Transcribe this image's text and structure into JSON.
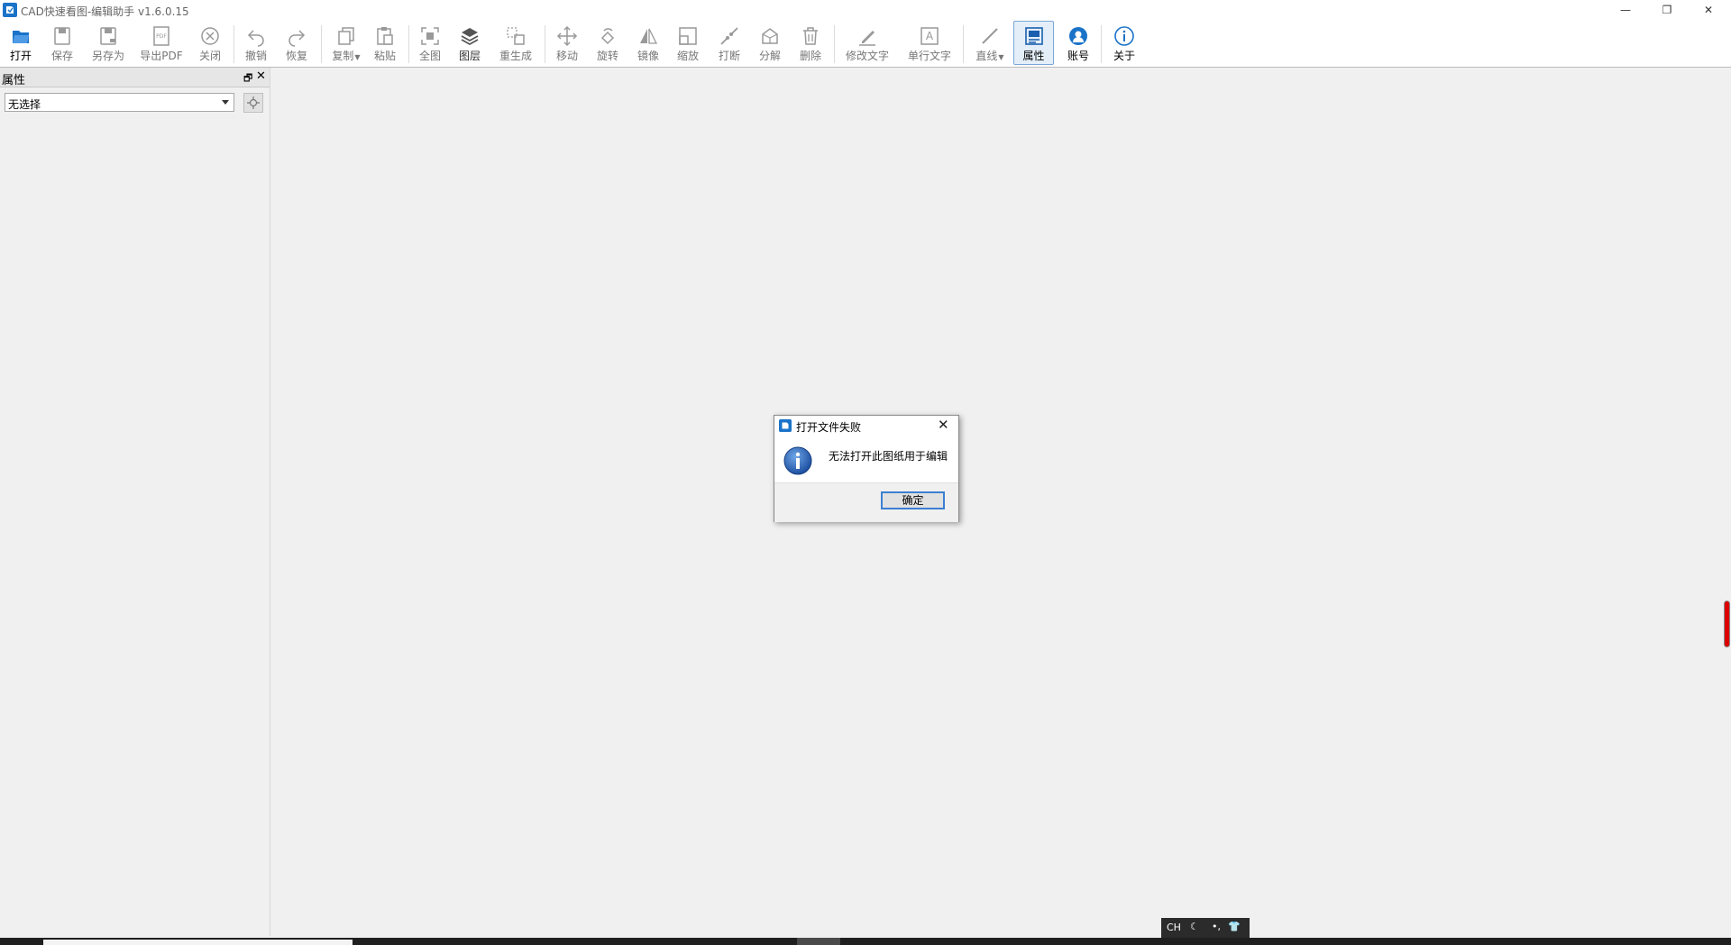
{
  "window": {
    "title": "CAD快速看图-编辑助手 v1.6.0.15",
    "controls": [
      "—",
      "❐",
      "✕"
    ]
  },
  "toolbar": {
    "buttons": [
      {
        "label": "打开",
        "icon": "open-folder-icon"
      },
      {
        "label": "保存",
        "icon": "save-icon"
      },
      {
        "label": "另存为",
        "icon": "save-as-icon"
      },
      {
        "label": "导出PDF",
        "icon": "export-pdf-icon"
      },
      {
        "label": "关闭",
        "icon": "close-circle-icon"
      },
      {
        "label": "撤销",
        "icon": "undo-icon"
      },
      {
        "label": "恢复",
        "icon": "redo-icon"
      },
      {
        "label": "复制",
        "icon": "copy-icon"
      },
      {
        "label": "粘贴",
        "icon": "paste-icon"
      },
      {
        "label": "全图",
        "icon": "fit-view-icon"
      },
      {
        "label": "图层",
        "icon": "layers-icon"
      },
      {
        "label": "重生成",
        "icon": "regenerate-icon"
      },
      {
        "label": "移动",
        "icon": "move-icon"
      },
      {
        "label": "旋转",
        "icon": "rotate-icon"
      },
      {
        "label": "镜像",
        "icon": "mirror-icon"
      },
      {
        "label": "缩放",
        "icon": "scale-icon"
      },
      {
        "label": "打断",
        "icon": "break-icon"
      },
      {
        "label": "分解",
        "icon": "explode-icon"
      },
      {
        "label": "删除",
        "icon": "trash-icon"
      },
      {
        "label": "修改文字",
        "icon": "edit-text-icon"
      },
      {
        "label": "单行文字",
        "icon": "single-line-text-icon"
      },
      {
        "label": "直线",
        "icon": "line-icon"
      },
      {
        "label": "属性",
        "icon": "properties-icon"
      },
      {
        "label": "账号",
        "icon": "account-icon"
      },
      {
        "label": "关于",
        "icon": "info-icon"
      }
    ]
  },
  "panel": {
    "title": "属性",
    "select_value": "无选择"
  },
  "dialog": {
    "title": "打开文件失败",
    "message": "无法打开此图纸用于编辑",
    "ok_label": "确定"
  },
  "tray": {
    "lang": "CH"
  },
  "colors": {
    "accent": "#1a73c8",
    "dialog_button_border": "#3c7fd1",
    "canvas": "#f0f0f0"
  }
}
